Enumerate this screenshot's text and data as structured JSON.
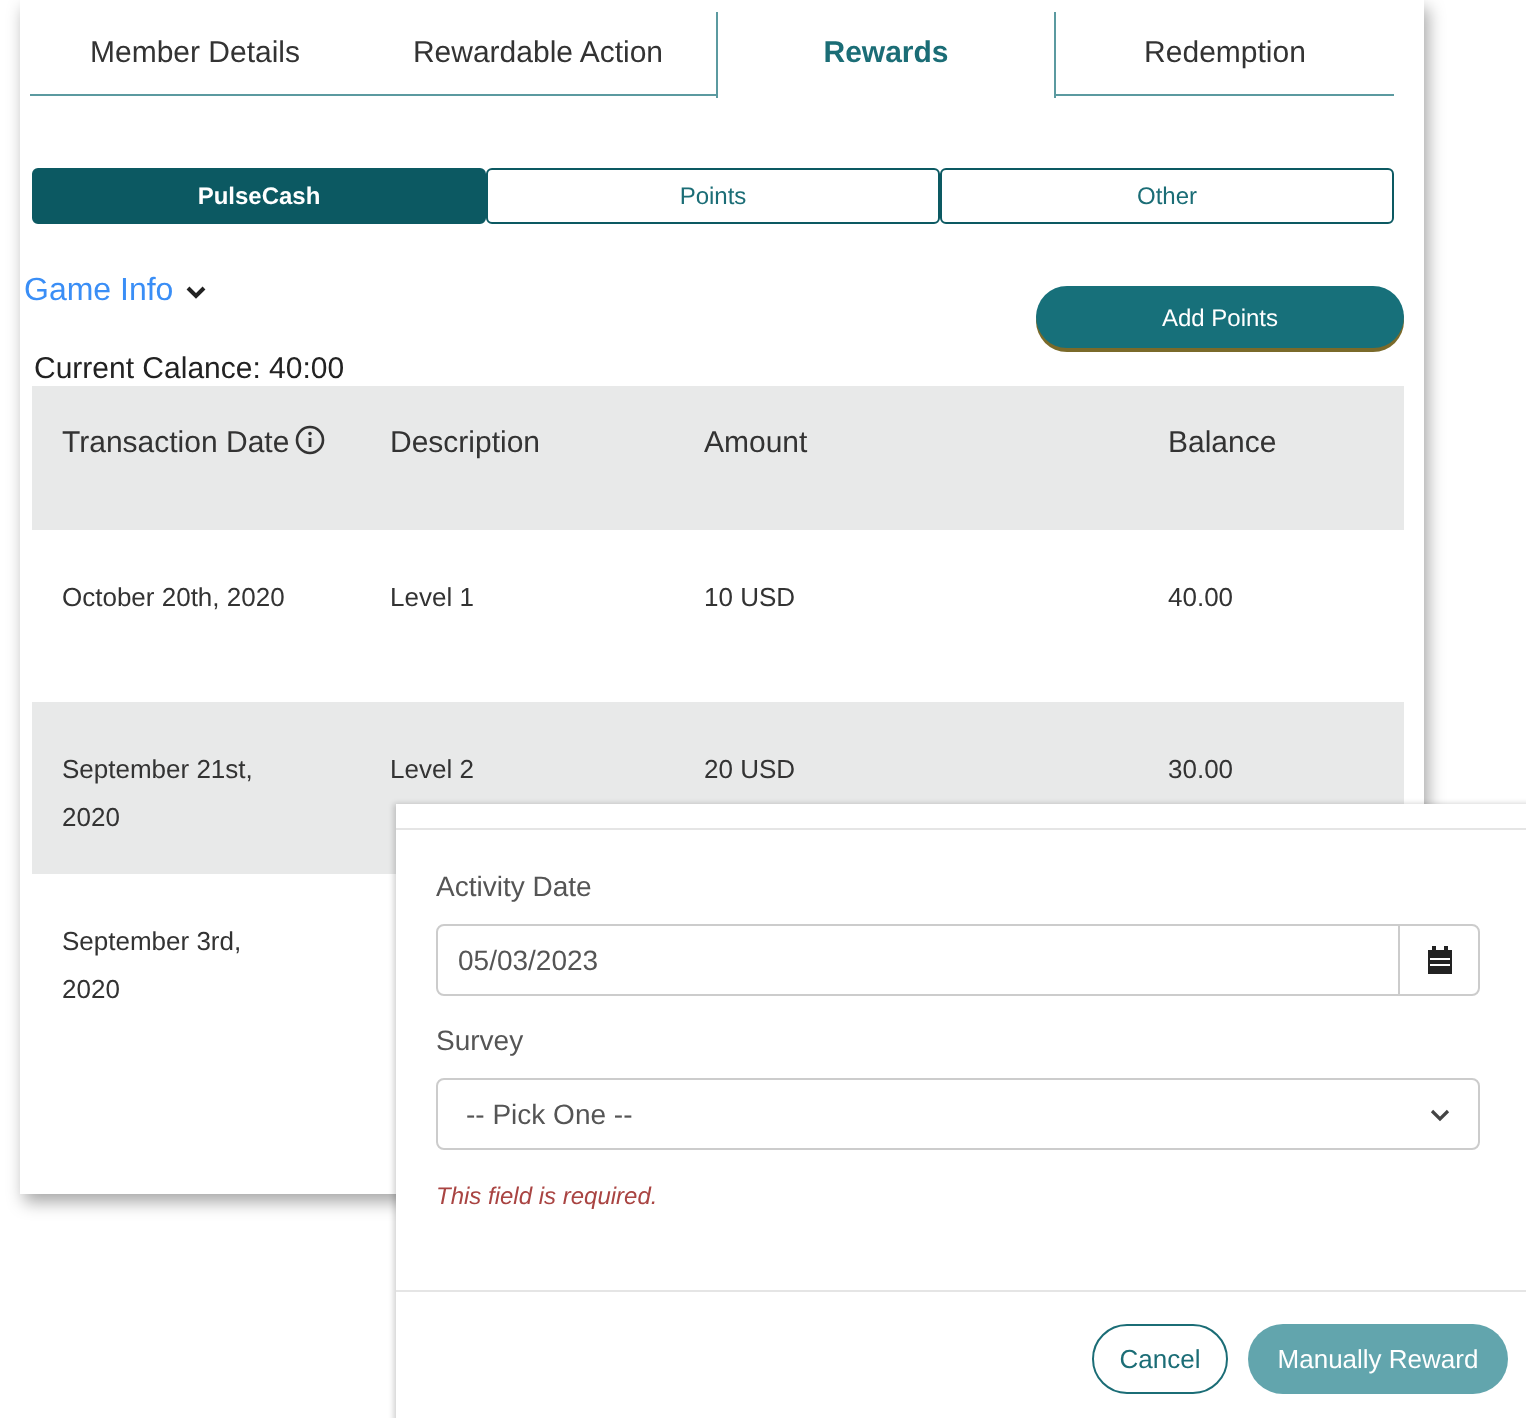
{
  "tabs": [
    {
      "label": "Member Details",
      "selected": false
    },
    {
      "label": "Rewardable Action",
      "selected": false
    },
    {
      "label": "Rewards",
      "selected": true
    },
    {
      "label": "Redemption",
      "selected": false
    }
  ],
  "segments": [
    {
      "label": "PulseCash",
      "selected": true
    },
    {
      "label": "Points",
      "selected": false
    },
    {
      "label": "Other",
      "selected": false
    }
  ],
  "game_info": {
    "label": "Game Info",
    "expanded": false
  },
  "add_button": "Add Points",
  "current_balance": "Current Calance: 40:00",
  "table": {
    "columns": [
      "Transaction Date",
      "Description",
      "Amount",
      "Balance"
    ],
    "rows": [
      [
        "October 20th, 2020",
        "Level 1",
        "10 USD",
        "40.00"
      ],
      [
        "September 21st, 2020",
        "Level 2",
        "20 USD",
        "30.00"
      ],
      [
        "September 3rd, 2020"
      ]
    ]
  },
  "dialog": {
    "date_label": "Activity Date",
    "date_value": "05/03/2023",
    "survey_label": "Survey",
    "survey_placeholder": "-- Pick One --",
    "error": "This field is required.",
    "buttons": [
      {
        "label": "Cancel",
        "kind": "secondary"
      },
      {
        "label": "Manually Reward",
        "kind": "primary"
      }
    ]
  }
}
